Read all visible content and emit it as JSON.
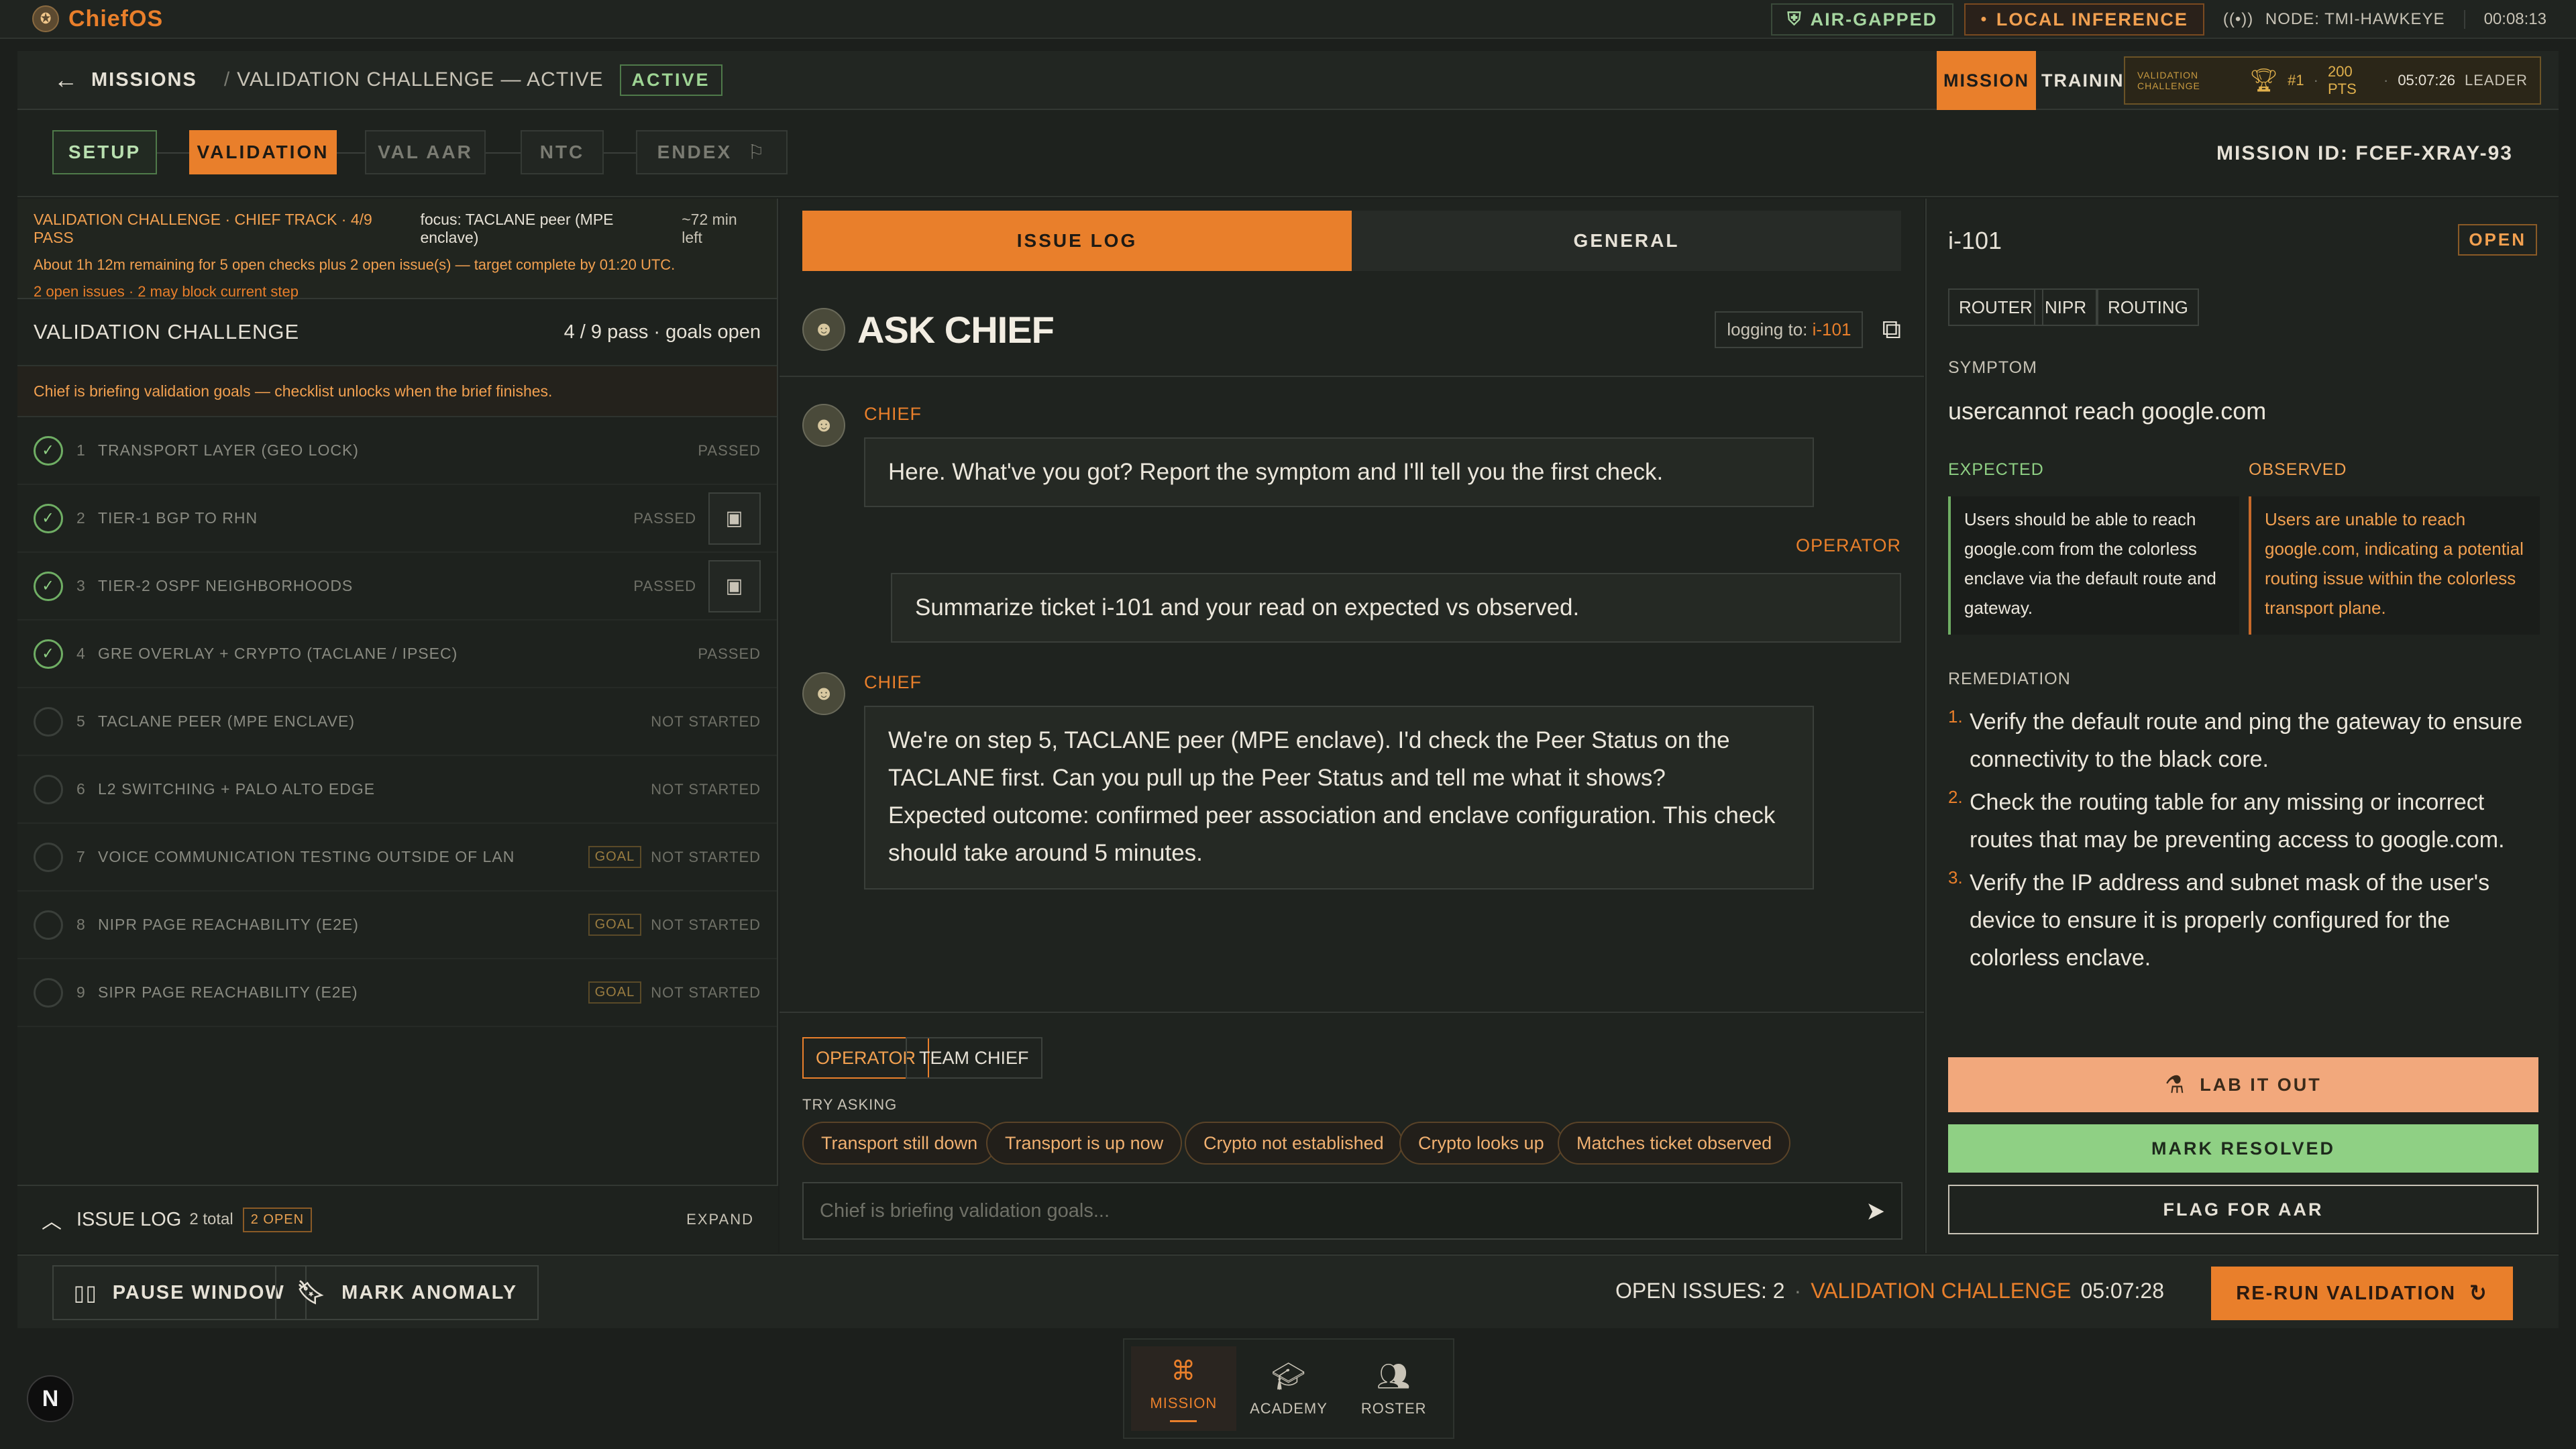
{
  "topbar": {
    "app_name": "ChiefOS",
    "air_gapped": "AIR-GAPPED",
    "local_inference": "LOCAL INFERENCE",
    "node": "NODE: TMI-HAWKEYE",
    "clock": "00:08:13"
  },
  "header": {
    "back_label": "MISSIONS",
    "breadcrumb": "VALIDATION CHALLENGE — ACTIVE",
    "breadcrumb_sep": "/",
    "status": "ACTIVE",
    "mode_tabs": [
      "MISSION",
      "TRAINING"
    ],
    "leader": {
      "label": "VALIDATION CHALLENGE",
      "rank": "#1",
      "points": "200 PTS",
      "time": "05:07:26",
      "role": "LEADER"
    }
  },
  "steps": {
    "items": [
      {
        "label": "SETUP",
        "state": "done"
      },
      {
        "label": "VALIDATION",
        "state": "current"
      },
      {
        "label": "VAL AAR",
        "state": "todo"
      },
      {
        "label": "NTC",
        "state": "todo"
      },
      {
        "label": "ENDEX",
        "state": "todo"
      }
    ],
    "mission_id": "MISSION ID: FCEF-XRAY-93"
  },
  "left": {
    "brief": {
      "track": "VALIDATION CHALLENGE · CHIEF TRACK · 4/9 PASS",
      "focus": "focus: TACLANE peer (MPE enclave)",
      "time_left": "~72 min left",
      "remaining": "About 1h 12m remaining for 5 open checks plus 2 open issue(s) — target complete by 01:20 UTC.",
      "issues": "2 open issues · 2 may block current step"
    },
    "challenge_title": "VALIDATION CHALLENGE",
    "challenge_count": "4 / 9 pass · goals open",
    "gate_message": "Chief is briefing validation goals — checklist unlocks when the brief finishes.",
    "items": [
      {
        "num": "1",
        "label": "TRANSPORT LAYER (GEO LOCK)",
        "status": "PASSED",
        "goal": "",
        "done": true,
        "term": false
      },
      {
        "num": "2",
        "label": "TIER-1 BGP TO RHN",
        "status": "PASSED",
        "goal": "",
        "done": true,
        "term": true
      },
      {
        "num": "3",
        "label": "TIER-2 OSPF NEIGHBORHOODS",
        "status": "PASSED",
        "goal": "",
        "done": true,
        "term": true
      },
      {
        "num": "4",
        "label": "GRE OVERLAY + CRYPTO (TACLANE / IPSEC)",
        "status": "PASSED",
        "goal": "",
        "done": true,
        "term": false
      },
      {
        "num": "5",
        "label": "TACLANE PEER (MPE ENCLAVE)",
        "status": "NOT STARTED",
        "goal": "",
        "done": false,
        "term": false
      },
      {
        "num": "6",
        "label": "L2 SWITCHING + PALO ALTO EDGE",
        "status": "NOT STARTED",
        "goal": "",
        "done": false,
        "term": false
      },
      {
        "num": "7",
        "label": "VOICE COMMUNICATION TESTING OUTSIDE OF LAN",
        "status": "NOT STARTED",
        "goal": "GOAL",
        "done": false,
        "term": false
      },
      {
        "num": "8",
        "label": "NIPR PAGE REACHABILITY (E2E)",
        "status": "NOT STARTED",
        "goal": "GOAL",
        "done": false,
        "term": false
      },
      {
        "num": "9",
        "label": "SIPR PAGE REACHABILITY (E2E)",
        "status": "NOT STARTED",
        "goal": "GOAL",
        "done": false,
        "term": false
      }
    ],
    "issue_log": {
      "title": "ISSUE LOG",
      "total": "2 total",
      "open": "2 OPEN",
      "expand": "EXPAND"
    }
  },
  "center": {
    "tabs": [
      "ISSUE LOG",
      "GENERAL"
    ],
    "title": "ASK CHIEF",
    "logging_prefix": "logging to:",
    "logging_target": "i-101",
    "messages": [
      {
        "who": "CHIEF",
        "text": "Here. What've you got? Report the symptom and I'll tell you the first check."
      },
      {
        "who": "OPERATOR",
        "text": "Summarize ticket i-101 and your read on expected vs observed."
      },
      {
        "who": "CHIEF",
        "text": "We're on step 5, TACLANE peer (MPE enclave). I'd check the Peer Status on the TACLANE first. Can you pull up the Peer Status and tell me what it shows?\nExpected outcome: confirmed peer association and enclave configuration. This check should take around 5 minutes."
      }
    ],
    "roles": [
      "OPERATOR",
      "TEAM CHIEF"
    ],
    "try_asking": "TRY ASKING",
    "chips": [
      "Transport still down",
      "Transport is up now",
      "Crypto not established",
      "Crypto looks up",
      "Matches ticket observed"
    ],
    "input_placeholder": "Chief is briefing validation goals..."
  },
  "right": {
    "ticket_id": "i-101",
    "status": "OPEN",
    "tags": [
      "ROUTER",
      "NIPR",
      "ROUTING"
    ],
    "symptom_label": "SYMPTOM",
    "symptom": "usercannot reach google.com",
    "expected_label": "EXPECTED",
    "expected": "Users should be able to reach google.com from the colorless enclave via the default route and gateway.",
    "observed_label": "OBSERVED",
    "observed": "Users are unable to reach google.com, indicating a potential routing issue within the colorless transport plane.",
    "remediation_label": "REMEDIATION",
    "remediation": [
      {
        "n": "1.",
        "text": "Verify the default route and ping the gateway to ensure connectivity to the black core."
      },
      {
        "n": "2.",
        "text": "Check the routing table for any missing or incorrect routes that may be preventing access to google.com."
      },
      {
        "n": "3.",
        "text": "Verify the IP address and subnet mask of the user's device to ensure it is properly configured for the colorless enclave."
      }
    ],
    "lab_button": "LAB IT OUT",
    "resolve_button": "MARK RESOLVED",
    "flag_button": "FLAG FOR AAR"
  },
  "actionbar": {
    "pause": "PAUSE WINDOW",
    "anomaly": "MARK ANOMALY",
    "open_issues": "OPEN ISSUES: 2",
    "dot": "·",
    "challenge": "VALIDATION CHALLENGE",
    "timer": "05:07:28",
    "rerun": "RE-RUN VALIDATION"
  },
  "nav": {
    "items": [
      {
        "label": "MISSION",
        "icon": "sitemap-icon"
      },
      {
        "label": "ACADEMY",
        "icon": "graduation-cap-icon"
      },
      {
        "label": "ROSTER",
        "icon": "users-icon"
      }
    ],
    "badge": "N"
  },
  "colors": {
    "accent": "#e97f2b",
    "success": "#8fd084",
    "background": "#1c1f1c"
  }
}
